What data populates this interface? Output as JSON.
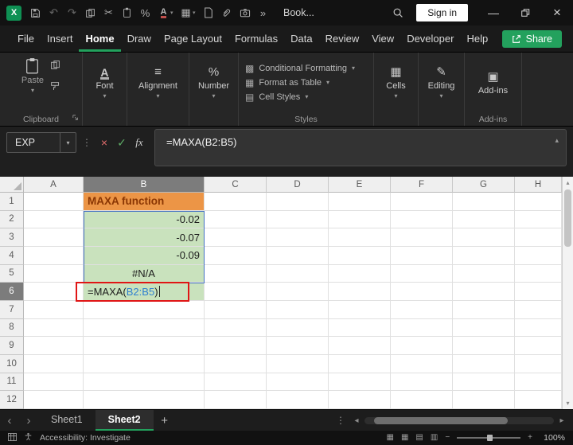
{
  "titlebar": {
    "workbook_title": "Book...",
    "sign_in": "Sign in"
  },
  "menu": {
    "tabs": [
      "File",
      "Insert",
      "Home",
      "Draw",
      "Page Layout",
      "Formulas",
      "Data",
      "Review",
      "View",
      "Developer",
      "Help"
    ],
    "active_tab": "Home",
    "share": "Share"
  },
  "ribbon": {
    "paste": "Paste",
    "clipboard_group": "Clipboard",
    "font": "Font",
    "alignment": "Alignment",
    "number": "Number",
    "conditional_formatting": "Conditional Formatting",
    "format_as_table": "Format as Table",
    "cell_styles": "Cell Styles",
    "styles_group": "Styles",
    "cells": "Cells",
    "editing": "Editing",
    "addins": "Add-ins",
    "addins_group": "Add-ins"
  },
  "formula_bar": {
    "name_box": "EXP",
    "fx": "fx",
    "formula": "=MAXA(B2:B5)"
  },
  "grid": {
    "columns": [
      "A",
      "B",
      "C",
      "D",
      "E",
      "F",
      "G",
      "H"
    ],
    "row_count": 12,
    "selected_column": "B",
    "selected_row": 6,
    "cells": {
      "B1": {
        "style": "title",
        "text": "MAXA function"
      },
      "B2": {
        "style": "value",
        "text": "-0.02"
      },
      "B3": {
        "style": "value",
        "text": "-0.07"
      },
      "B4": {
        "style": "value",
        "text": "-0.09"
      },
      "B5": {
        "style": "error",
        "text": "#N/A"
      },
      "B6": {
        "style": "formula",
        "parts": {
          "prefix": "=MAXA(",
          "ref": "B2:B5",
          "suffix": ")"
        }
      }
    }
  },
  "sheet_bar": {
    "tabs": [
      "Sheet1",
      "Sheet2"
    ],
    "active_tab": "Sheet2",
    "add": "+"
  },
  "status_bar": {
    "accessibility": "Accessibility: Investigate",
    "zoom": "100%"
  },
  "icons": {
    "excel_logo": "X",
    "undo": "↶",
    "redo": "↷",
    "cut": "✂",
    "percent": "%",
    "overflow": "»",
    "minimize": "—",
    "close": "×",
    "dropdown": "▾",
    "collapse": "▴",
    "dots": "⋮",
    "cancel": "×",
    "check": "✓",
    "font_a": "A",
    "align": "≡",
    "cond_format": "▩",
    "format_table": "▦",
    "cell_styles": "▤",
    "cells": "▦",
    "editing": "✎",
    "addins": "▣",
    "borders": "▦",
    "nav_left": "‹",
    "nav_right": "›",
    "hscroll_left": "◂",
    "hscroll_right": "▸",
    "vscroll_up": "▴",
    "vscroll_down": "▾",
    "view_grid": "▦",
    "view_normal": "▦",
    "view_layout": "▤",
    "view_break": "▥",
    "zoom_out": "−",
    "zoom_in": "+"
  },
  "colors": {
    "accent_green": "#23A15D",
    "cell_green": "#C9E2BD",
    "cell_orange": "#EC9546",
    "title_text": "#8A3603",
    "ref_blue": "#2F7FD0",
    "annotation_red": "#E01515",
    "selected_header_gray": "#7C7C7C"
  }
}
